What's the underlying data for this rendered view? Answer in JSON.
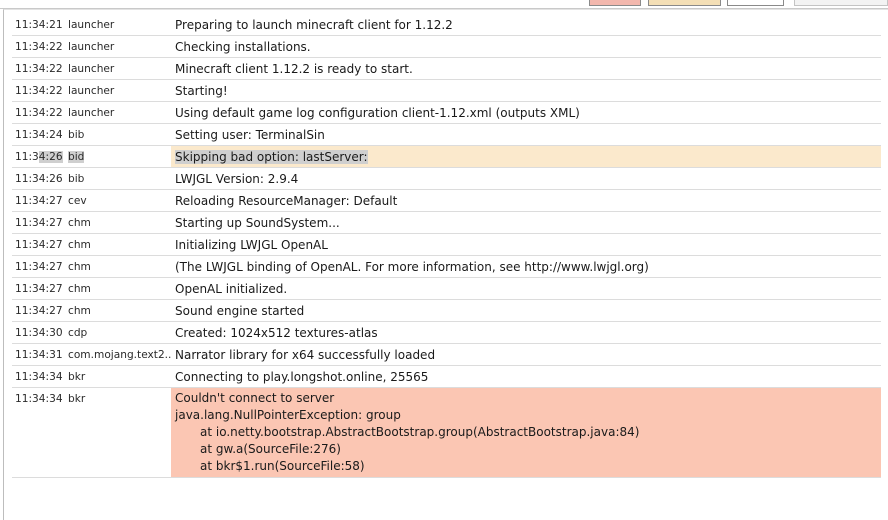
{
  "log": [
    {
      "time": "11:34:21",
      "source": "launcher",
      "message": "Preparing to launch minecraft client for 1.12.2"
    },
    {
      "time": "11:34:22",
      "source": "launcher",
      "message": "Checking installations."
    },
    {
      "time": "11:34:22",
      "source": "launcher",
      "message": "Minecraft client 1.12.2 is ready to start."
    },
    {
      "time": "11:34:22",
      "source": "launcher",
      "message": "Starting!"
    },
    {
      "time": "11:34:22",
      "source": "launcher",
      "message": "Using default game log configuration client-1.12.xml (outputs XML)"
    },
    {
      "time": "11:34:24",
      "source": "bib",
      "message": "Setting user: TerminalSin"
    },
    {
      "time_a": "11:3",
      "time_b": "4:26",
      "source": "bid",
      "message": "Skipping bad option: lastServer:"
    },
    {
      "time": "11:34:26",
      "source": "bib",
      "message": "LWJGL Version: 2.9.4"
    },
    {
      "time": "11:34:27",
      "source": "cev",
      "message": "Reloading ResourceManager: Default"
    },
    {
      "time": "11:34:27",
      "source": "chm",
      "message": "Starting up SoundSystem..."
    },
    {
      "time": "11:34:27",
      "source": "chm",
      "message": "Initializing LWJGL OpenAL"
    },
    {
      "time": "11:34:27",
      "source": "chm",
      "message": "(The LWJGL binding of OpenAL.  For more information, see http://www.lwjgl.org)"
    },
    {
      "time": "11:34:27",
      "source": "chm",
      "message": "OpenAL initialized."
    },
    {
      "time": "11:34:27",
      "source": "chm",
      "message": "Sound engine started"
    },
    {
      "time": "11:34:30",
      "source": "cdp",
      "message": "Created: 1024x512 textures-atlas"
    },
    {
      "time": "11:34:31",
      "source": "com.mojang.text2...",
      "message": "Narrator library for x64 successfully loaded"
    },
    {
      "time": "11:34:34",
      "source": "bkr",
      "message": "Connecting to play.longshot.online, 25565"
    },
    {
      "time": "11:34:34",
      "source": "bkr",
      "lines": [
        "Couldn't connect to server",
        "java.lang.NullPointerException: group",
        "at io.netty.bootstrap.AbstractBootstrap.group(AbstractBootstrap.java:84)",
        "at gw.a(SourceFile:276)",
        "at bkr$1.run(SourceFile:58)"
      ]
    }
  ],
  "colors": {
    "warning_row": "#fbe9cc",
    "error_row": "#fbc6b3",
    "selection": "#cfcfcf"
  }
}
